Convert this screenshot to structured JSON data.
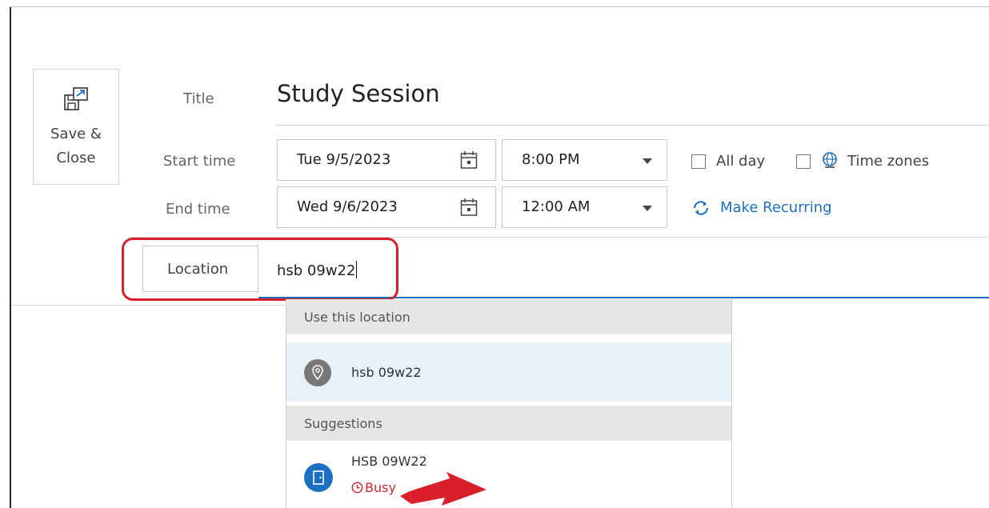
{
  "toolbar": {
    "save_close_line1": "Save &",
    "save_close_line2": "Close",
    "save_icon": "save-close-icon"
  },
  "form": {
    "title_label": "Title",
    "title_value": "Study Session",
    "start_label": "Start time",
    "start_date": "Tue 9/5/2023",
    "start_time": "8:00 PM",
    "end_label": "End time",
    "end_date": "Wed 9/6/2023",
    "end_time": "12:00 AM",
    "all_day_label": "All day",
    "all_day_checked": false,
    "time_zones_label": "Time zones",
    "time_zones_checked": false,
    "make_recurring_label": "Make Recurring",
    "location_button": "Location",
    "location_value": "hsb 09w22"
  },
  "dropdown": {
    "header_use": "Use this location",
    "use_item": "hsb 09w22",
    "header_suggestions": "Suggestions",
    "suggestion_name": "HSB 09W22",
    "suggestion_status": "Busy"
  },
  "colors": {
    "accent": "#1f6fbe",
    "highlight_red": "#d9202a",
    "busy_red": "#d6262e",
    "room_blue": "#1c6fc3"
  }
}
